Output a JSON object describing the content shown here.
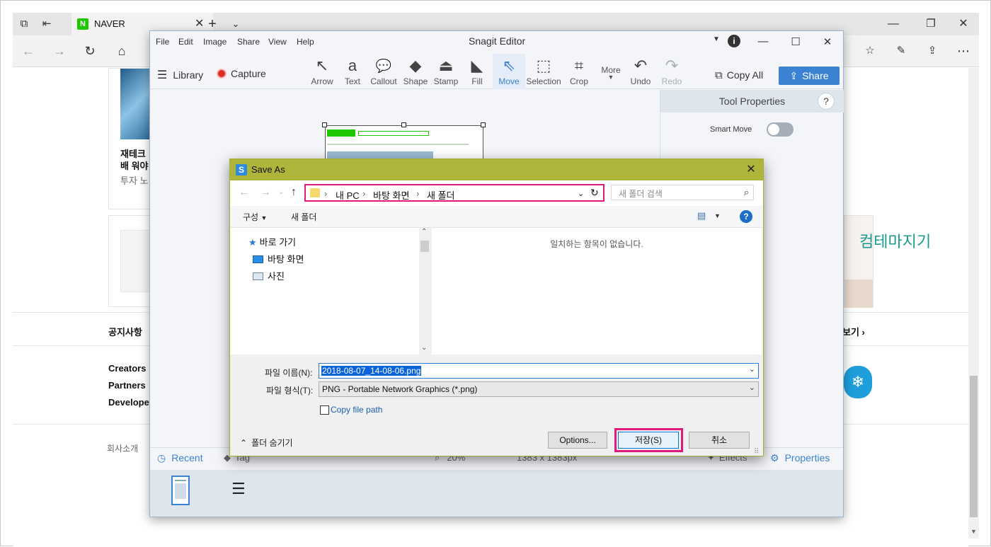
{
  "browser": {
    "tab_title": "NAVER",
    "naver_logo_letter": "N"
  },
  "naver_page": {
    "article_title_line1": "재테크",
    "article_title_line2": "배 워야",
    "article_sub": "투자 노",
    "notice_label": "공지사항",
    "more_label": "보기 ›",
    "footer_links": [
      "Creators",
      "Partners",
      "Develope"
    ],
    "company_intro": "회사소개",
    "handwriting": "컴테마지기"
  },
  "snagit": {
    "menu": [
      "File",
      "Edit",
      "Image",
      "Share",
      "View",
      "Help"
    ],
    "title": "Snagit Editor",
    "library_label": "Library",
    "capture_label": "Capture",
    "tools": [
      {
        "icon": "↖",
        "label": "Arrow"
      },
      {
        "icon": "a",
        "label": "Text"
      },
      {
        "icon": "💬",
        "label": "Callout"
      },
      {
        "icon": "◆",
        "label": "Shape"
      },
      {
        "icon": "⏏",
        "label": "Stamp"
      },
      {
        "icon": "◣",
        "label": "Fill"
      },
      {
        "icon": "⇖",
        "label": "Move"
      },
      {
        "icon": "⬚",
        "label": "Selection"
      },
      {
        "icon": "⌗",
        "label": "Crop"
      }
    ],
    "more_label": "More",
    "undo_label": "Undo",
    "redo_label": "Redo",
    "copy_all_label": "Copy All",
    "share_label": "Share",
    "tool_properties_title": "Tool Properties",
    "smart_move_label": "Smart Move",
    "smart_move_on": false,
    "bottom": {
      "recent_label": "Recent",
      "tag_label": "Tag",
      "zoom": "20%",
      "dimensions": "1383 x 1383px",
      "effects_label": "Effects",
      "properties_label": "Properties"
    }
  },
  "save_as": {
    "title": "Save As",
    "breadcrumb": [
      "내 PC",
      "바탕 화면",
      "새 폴더"
    ],
    "search_placeholder": "새 폴더 검색",
    "organize_label": "구성",
    "new_folder_label": "새 폴더",
    "tree": [
      "바로 가기",
      "바탕 화면",
      "사진"
    ],
    "empty_message": "일치하는 항목이 없습니다.",
    "filename_label": "파일 이름(N):",
    "filename_value": "2018-08-07_14-08-06.png",
    "filetype_label": "파일 형식(T):",
    "filetype_value": "PNG - Portable Network Graphics (*.png)",
    "copy_file_path_label": "Copy file path",
    "copy_file_path_checked": false,
    "hide_folders_label": "폴더 숨기기",
    "options_label": "Options...",
    "save_label": "저장(S)",
    "cancel_label": "취소"
  },
  "colors": {
    "dialog_titlebar": "#afb43a",
    "highlight_outline": "#e0197d",
    "snagit_accent": "#3c82d2"
  }
}
